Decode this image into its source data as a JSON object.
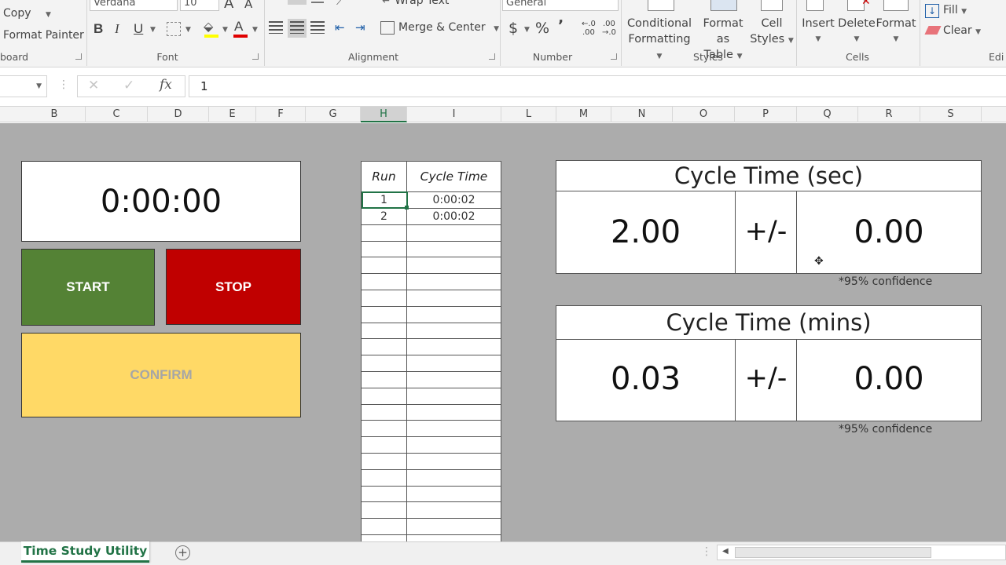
{
  "ribbon": {
    "clipboard": {
      "copy": "Copy",
      "format_painter": "Format Painter",
      "label": "board"
    },
    "font": {
      "family": "Verdana",
      "size": "10",
      "grow": "A",
      "shrink": "A",
      "bold": "B",
      "italic": "I",
      "underline": "U",
      "font_color": "A",
      "label": "Font"
    },
    "alignment": {
      "wrap_text": "Wrap Text",
      "merge_center": "Merge & Center",
      "label": "Alignment"
    },
    "number": {
      "format": "General",
      "currency": "$",
      "percent": "%",
      "comma": "ʼ",
      "inc_decimal_top": "←.0",
      "inc_decimal_bottom": ".00",
      "dec_decimal_top": ".00",
      "dec_decimal_bottom": "→.0",
      "label": "Number"
    },
    "styles": {
      "conditional_line1": "Conditional",
      "conditional_line2": "Formatting",
      "format_table_line1": "Format as",
      "format_table_line2": "Table",
      "cell_styles_line1": "Cell",
      "cell_styles_line2": "Styles",
      "label": "Styles"
    },
    "cells": {
      "insert": "Insert",
      "delete": "Delete",
      "format": "Format",
      "label": "Cells"
    },
    "editing": {
      "fill": "Fill",
      "clear": "Clear",
      "label": "Edi"
    }
  },
  "formula_bar": {
    "value": "1",
    "fx": "fx"
  },
  "columns": [
    "B",
    "C",
    "D",
    "E",
    "F",
    "G",
    "H",
    "I",
    "L",
    "M",
    "N",
    "O",
    "P",
    "Q",
    "R",
    "S"
  ],
  "selected_column": "H",
  "sheet": {
    "timer": "0:00:00",
    "start_label": "START",
    "stop_label": "STOP",
    "confirm_label": "CONFIRM",
    "colors": {
      "start": "#548235",
      "stop": "#c00000",
      "confirm": "#ffd966",
      "confirm_text": "#a6a6a6",
      "sheet_bg": "#acacac"
    },
    "run_table": {
      "headers": [
        "Run",
        "Cycle Time"
      ],
      "rows": [
        {
          "run": "1",
          "cycle_time": "0:00:02"
        },
        {
          "run": "2",
          "cycle_time": "0:00:02"
        }
      ]
    },
    "stats_sec": {
      "title": "Cycle Time (sec)",
      "mean": "2.00",
      "pm": "+/-",
      "margin": "0.00",
      "note": "*95% confidence"
    },
    "stats_min": {
      "title": "Cycle Time (mins)",
      "mean": "0.03",
      "pm": "+/-",
      "margin": "0.00",
      "note": "*95% confidence"
    }
  },
  "tabs": {
    "active": "Time Study Utility",
    "add": "+"
  }
}
